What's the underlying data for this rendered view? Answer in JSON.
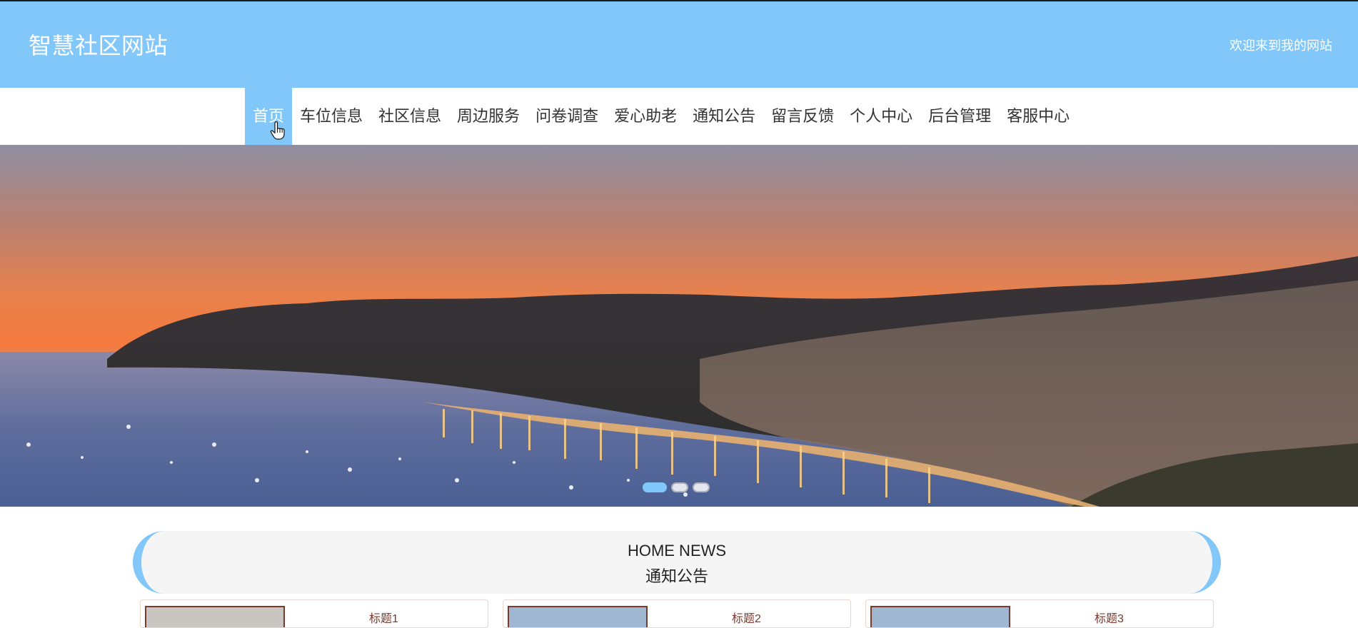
{
  "header": {
    "site_title": "智慧社区网站",
    "welcome": "欢迎来到我的网站"
  },
  "nav": {
    "items": [
      {
        "label": "首页",
        "active": true
      },
      {
        "label": "车位信息"
      },
      {
        "label": "社区信息"
      },
      {
        "label": "周边服务"
      },
      {
        "label": "问卷调查"
      },
      {
        "label": "爱心助老"
      },
      {
        "label": "通知公告"
      },
      {
        "label": "留言反馈"
      },
      {
        "label": "个人中心"
      },
      {
        "label": "后台管理"
      },
      {
        "label": "客服中心"
      }
    ]
  },
  "banner": {
    "slide_count": 3,
    "active_slide": 1
  },
  "news": {
    "title_en": "HOME NEWS",
    "title_cn": "通知公告",
    "cards": [
      {
        "title": "标题1"
      },
      {
        "title": "标题2"
      },
      {
        "title": "标题3"
      }
    ]
  },
  "colors": {
    "brand": "#82c7fa",
    "nav_text": "#333333",
    "card_title": "#7a3b2e"
  }
}
